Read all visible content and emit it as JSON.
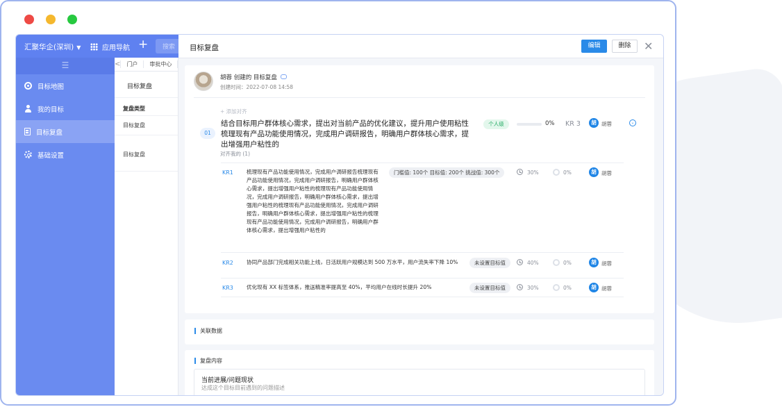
{
  "window": {
    "company": "汇聚华企(深圳)",
    "app_nav": "应用导航",
    "plus": "+",
    "search_placeholder": "搜索"
  },
  "sidebar": {
    "collapse": "☰",
    "items": [
      {
        "label": "目标地图",
        "icon": "target-icon"
      },
      {
        "label": "我的目标",
        "icon": "user-icon"
      },
      {
        "label": "目标复盘",
        "icon": "document-icon",
        "active": true
      },
      {
        "label": "基础设置",
        "icon": "gear-icon"
      }
    ]
  },
  "middle": {
    "back": "<",
    "tabs": [
      "门户",
      "审批中心"
    ],
    "title": "目标复盘",
    "column_header": "复盘类型",
    "rows": [
      "目标复盘",
      "目标复盘"
    ]
  },
  "drawer": {
    "title": "目标复盘",
    "edit_label": "编辑",
    "delete_label": "删除",
    "close": "✕"
  },
  "review": {
    "creator_line": "胡蓉 创建的 目标复盘",
    "created_time": "创建时间：2022-07-08 14:58",
    "add_alignment": "+ 添加对齐",
    "objective_index": "01",
    "objective_text": "结合目标用户群体核心需求，提出对当前产品的优化建议，提升用户使用粘性梳理现有产品功能使用情况，完成用户调研报告，明确用户群体核心需求，提出增强用户粘性的",
    "aligned_to_me": "对齐我的 (1)",
    "level_badge": "个人级",
    "progress_pct": "0%",
    "progress_value": 0,
    "kr_count": "KR 3",
    "owner_initial": "胡",
    "owner_name": "胡蓉",
    "collapse_icon": "⌄"
  },
  "krs": [
    {
      "label": "KR1",
      "text": "梳理现有产品功能使用情况，完成用户调研报告梳理现有产品功能使用情况，完成用户调研报告，明确用户群体核心需求，提出增强用户粘性的梳理现有产品功能使用情况，完成用户调研报告，明确用户群体核心需求，提出增强用户粘性的梳理现有产品功能使用情况，完成用户调研报告，明确用户群体核心需求，提出增强用户粘性的梳理现有产品功能使用情况，完成用户调研报告，明确用户群体核心需求，提出增强用户粘性的",
      "target_chip": "门槛值: 100个   目标值: 200个   挑战值: 300个",
      "time_pct": "30%",
      "progress": "0%",
      "owner_initial": "胡",
      "owner": "胡蓉"
    },
    {
      "label": "KR2",
      "text": "协同产品部门完成相关功能上线，日活跃用户规模达到 500 万水平，用户流失率下降 10%",
      "target_chip": "未设置目标值",
      "time_pct": "40%",
      "progress": "0%",
      "owner_initial": "胡",
      "owner": "胡蓉"
    },
    {
      "label": "KR3",
      "text": "优化现有 XX 标签体系，推送精准率提高至 40%，平均用户在线时长提升 20%",
      "target_chip": "未设置目标值",
      "time_pct": "30%",
      "progress": "0%",
      "owner_initial": "胡",
      "owner": "胡蓉"
    }
  ],
  "related": {
    "title": "关联数据"
  },
  "content": {
    "title": "复盘内容",
    "box_title": "当前进展/问题现状",
    "box_placeholder": "达成这个目标目前遇到的问题描述"
  },
  "colors": {
    "brand": "#5f81f0",
    "sidebar": "#6a8bf0",
    "primary_button": "#2a8ae8",
    "level_badge_bg": "#e3f7ec",
    "level_badge_text": "#2cae6a"
  }
}
